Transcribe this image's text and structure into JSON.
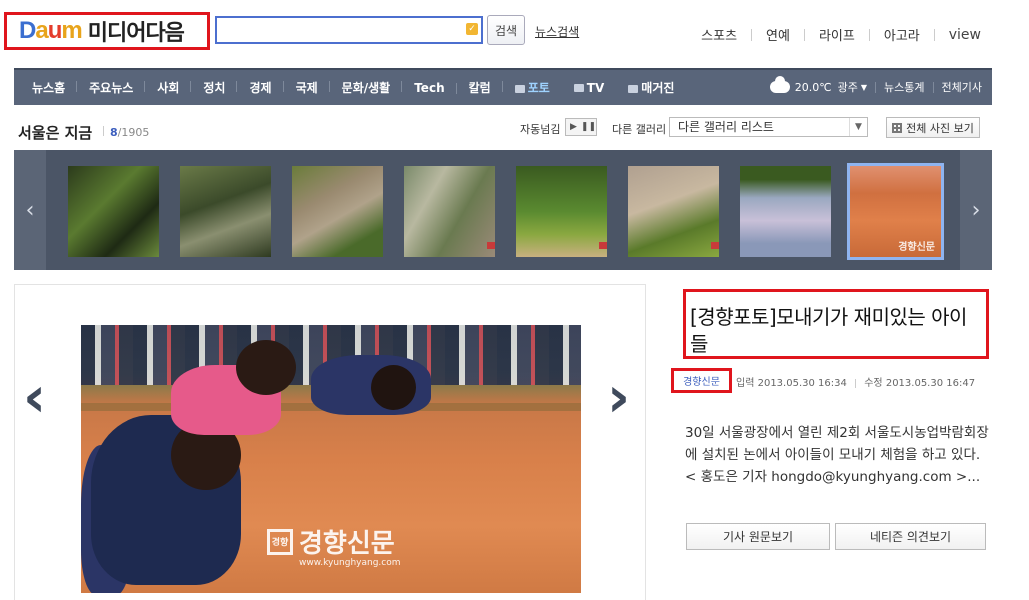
{
  "header": {
    "logo_brand": "Daum",
    "logo_text": "미디어다음",
    "search": {
      "value": "",
      "placeholder": ""
    },
    "search_button": "검색",
    "news_search": "뉴스검색",
    "top_links": [
      "스포츠",
      "연예",
      "라이프",
      "아고라",
      "view"
    ]
  },
  "gnb": {
    "items": [
      "뉴스홈",
      "주요뉴스",
      "사회",
      "정치",
      "경제",
      "국제",
      "문화/생활",
      "Tech",
      "칼럼",
      "포토",
      "TV",
      "매거진"
    ],
    "active": "포토",
    "weather": {
      "temp": "20.0℃",
      "city": "광주"
    },
    "right_links": [
      "뉴스통계",
      "전체기사"
    ]
  },
  "gallery": {
    "title": "서울은 지금",
    "current": "8",
    "total": "/1905",
    "auto_label": "자동넘김",
    "other_gallery_label": "다른 갤러리",
    "select_value": "다른 갤러리 리스트",
    "all_photos_button": "전체 사진 보기",
    "selected_index": 8
  },
  "article": {
    "title": "[경향포토]모내기가 재미있는 아이들",
    "press": "경향신문",
    "input_label": "입력",
    "input_time": "2013.05.30 16:34",
    "edit_label": "수정",
    "edit_time": "2013.05.30 16:47",
    "body": "30일 서울광장에서 열린 제2회 서울도시농업박람회장에 설치된 논에서 아이들이 모내기 체험을 하고 있다.< 홍도은 기자 hongdo@kyunghyang.com >...",
    "button_original": "기사 원문보기",
    "button_comments": "네티즌 의견보기"
  },
  "photo": {
    "watermark_text": "경향신문",
    "watermark_box": "경향",
    "watermark_url": "www.kyunghyang.com",
    "thumb_watermark": "경향신문"
  },
  "colors": {
    "accent_red": "#e0151d",
    "nav_bg": "#59657a",
    "link_blue": "#3d5fbe",
    "strip_bg": "#4b5566"
  }
}
